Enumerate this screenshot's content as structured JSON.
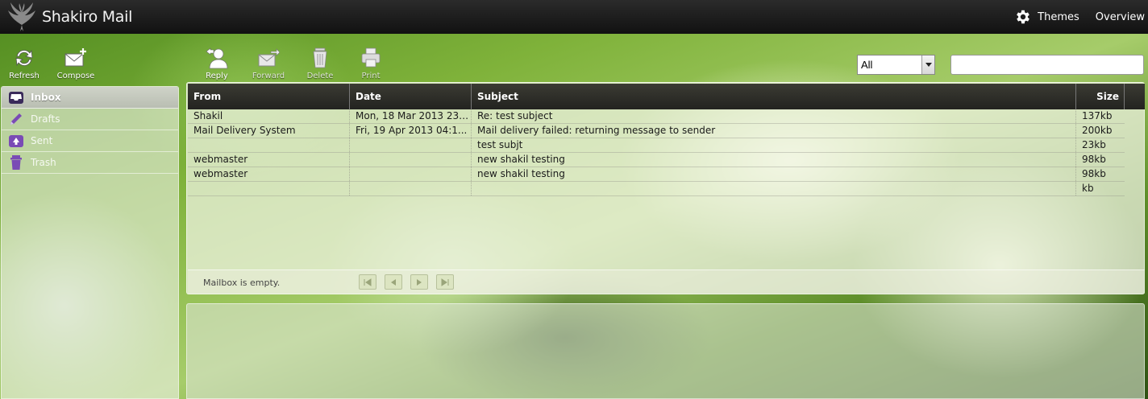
{
  "app": {
    "name": "Shakiro Mail",
    "logo_icon": "wings-logo-icon"
  },
  "topnav": {
    "themes_label": "Themes",
    "themes_icon": "gear-icon",
    "overview_label": "Overview"
  },
  "toolbar": {
    "refresh_label": "Refresh",
    "compose_label": "Compose",
    "reply_label": "Reply",
    "forward_label": "Forward",
    "delete_label": "Delete",
    "print_label": "Print"
  },
  "filter": {
    "selected": "All"
  },
  "search": {
    "value": "",
    "placeholder": ""
  },
  "folders": [
    {
      "label": "Inbox",
      "icon": "inbox-icon",
      "active": true
    },
    {
      "label": "Drafts",
      "icon": "pencil-icon",
      "active": false
    },
    {
      "label": "Sent",
      "icon": "sent-icon",
      "active": false
    },
    {
      "label": "Trash",
      "icon": "trash-icon",
      "active": false
    }
  ],
  "messages": {
    "columns": {
      "from": "From",
      "date": "Date",
      "subject": "Subject",
      "size": "Size"
    },
    "rows": [
      {
        "from": "Shakil",
        "date": "Mon, 18 Mar 2013 23:...",
        "subject": "Re: test subject",
        "size": "137kb"
      },
      {
        "from": "Mail Delivery System",
        "date": "Fri, 19 Apr 2013 04:1...",
        "subject": "Mail delivery failed: returning message to sender",
        "size": "200kb"
      },
      {
        "from": "",
        "date": "",
        "subject": "test subjt",
        "size": "23kb"
      },
      {
        "from": "webmaster",
        "date": "",
        "subject": "new shakil testing",
        "size": "98kb"
      },
      {
        "from": "webmaster",
        "date": "",
        "subject": "new shakil testing",
        "size": "98kb"
      },
      {
        "from": "",
        "date": "",
        "subject": "",
        "size": "kb"
      }
    ]
  },
  "pager": {
    "status": "Mailbox is empty."
  },
  "colors": {
    "topbar": "#1a1a1a",
    "header": "#2a2a25",
    "accent_purple": "#7a4bb5"
  }
}
